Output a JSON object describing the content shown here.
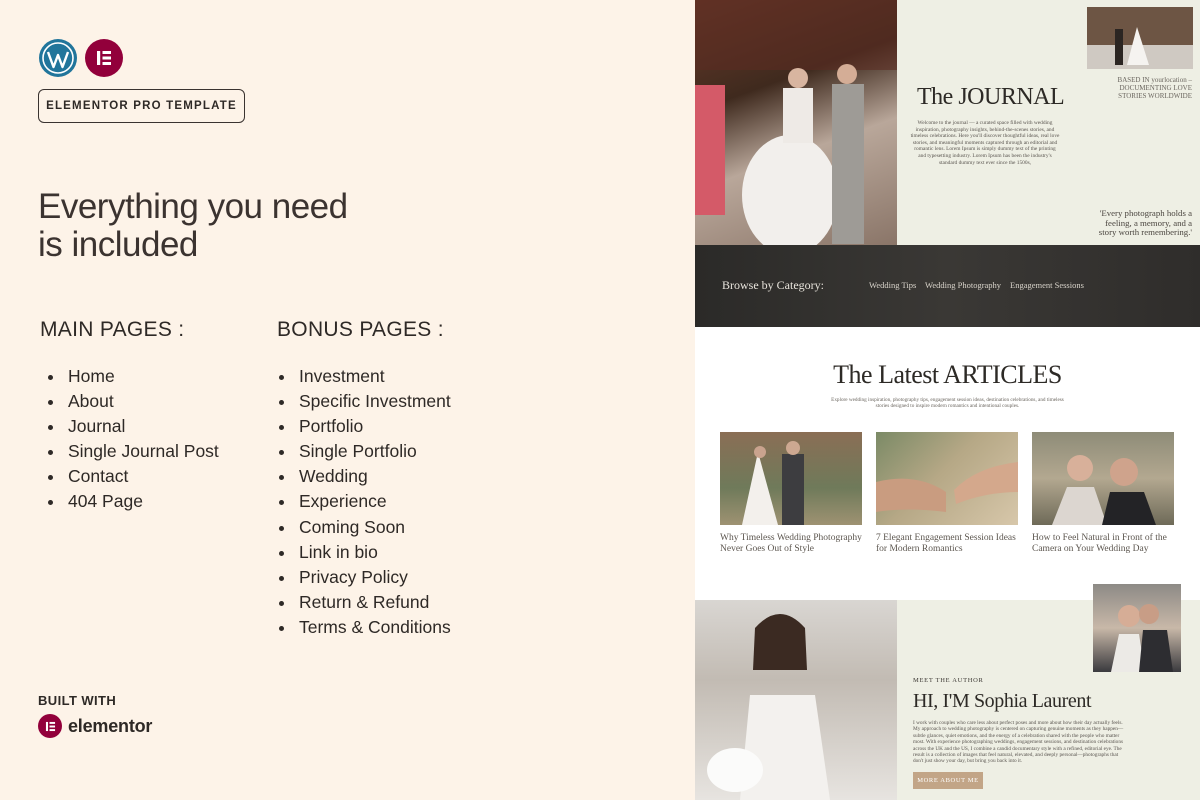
{
  "badge": {
    "label": "ELEMENTOR PRO TEMPLATE"
  },
  "headline": "Everything you need\nis included",
  "main_pages": {
    "title": "MAIN PAGES :",
    "items": [
      "Home",
      "About",
      "Journal",
      "Single Journal Post",
      "Contact",
      "404 Page"
    ]
  },
  "bonus_pages": {
    "title": "BONUS PAGES :",
    "items": [
      "Investment",
      "Specific Investment",
      "Portfolio",
      "Single Portfolio",
      "Wedding",
      "Experience",
      "Coming Soon",
      "Link in bio",
      "Privacy Policy",
      "Return & Refund",
      "Terms & Conditions"
    ]
  },
  "built_with": {
    "label": "BUILT WITH",
    "brand": "elementor"
  },
  "icons": {
    "wordpress": "wordpress-logo-icon",
    "elementor": "elementor-logo-icon"
  },
  "colors": {
    "wordpress": "#21759b",
    "elementor": "#92003b",
    "background": "#fdf3e8",
    "button": "#c2a587"
  },
  "preview": {
    "journal": {
      "title": "The JOURNAL",
      "body": "Welcome to the journal — a curated space filled with wedding inspiration, photography insights, behind-the-scenes stories, and timeless celebrations. Here you'll discover thoughtful ideas, real love stories, and meaningful moments captured through an editorial and romantic lens. Lorem Ipsum is simply dummy text of the printing and typesetting industry. Lorem Ipsum has been the industry's standard dummy text ever since the 1500s,",
      "based": "BASED IN yourlocation – DOCUMENTING LOVE STORIES WORLDWIDE",
      "quote": "'Every photograph holds a feeling, a memory, and a story worth remembering.'"
    },
    "browse": {
      "label": "Browse by Category:",
      "categories": [
        "Wedding Tips",
        "Wedding Photography",
        "Engagement Sessions"
      ]
    },
    "articles": {
      "title": "The Latest ARTICLES",
      "subtitle": "Explore wedding inspiration, photography tips, engagement session ideas, destination celebrations, and timeless stories designed to inspire modern romantics and intentional couples.",
      "cards": [
        {
          "title": "Why Timeless Wedding Photography Never Goes Out of Style"
        },
        {
          "title": "7 Elegant Engagement Session Ideas for Modern Romantics"
        },
        {
          "title": "How to Feel Natural in Front of the Camera on Your Wedding Day"
        }
      ]
    },
    "author": {
      "label": "MEET THE AUTHOR",
      "name": "HI, I'M Sophia Laurent",
      "body": "I work with couples who care less about perfect poses and more about how their day actually feels. My approach to wedding photography is centered on capturing genuine moments as they happen—subtle glances, quiet emotions, and the energy of a celebration shared with the people who matter most. With experience photographing weddings, engagement sessions, and destination celebrations across the UK and the US, I combine a candid documentary style with a refined, editorial eye. The result is a collection of images that feel natural, elevated, and deeply personal—photographs that don't just show your day, but bring you back into it.",
      "button": "MORE ABOUT ME"
    }
  }
}
